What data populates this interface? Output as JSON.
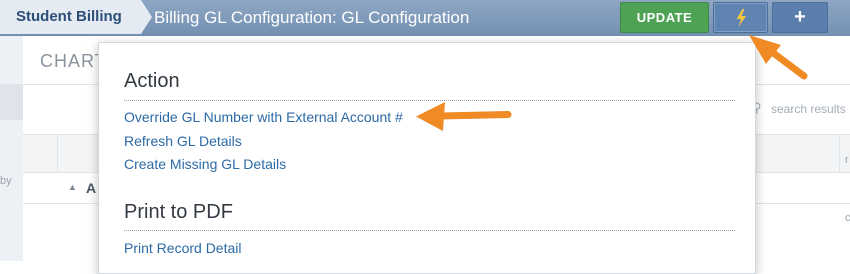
{
  "header": {
    "breadcrumb": "Student Billing",
    "title": "Billing GL Configuration: GL Configuration",
    "update_label": "UPDATE",
    "action_icon": "lightning-bolt-icon",
    "add_icon": "plus-icon",
    "add_glyph": "+"
  },
  "background": {
    "section_heading": "CHART",
    "column_label": "A",
    "side_text": "by",
    "search_placeholder": "search results"
  },
  "menu": {
    "sections": [
      {
        "title": "Action",
        "items": [
          "Override GL Number with External Account #",
          "Refresh GL Details",
          "Create Missing GL Details"
        ]
      },
      {
        "title": "Print to PDF",
        "items": [
          "Print Record Detail"
        ]
      }
    ]
  },
  "colors": {
    "header_bg": "#7f9aba",
    "update_green": "#4da353",
    "icon_button_blue": "#5a7fad",
    "bolt_yellow": "#f3c544",
    "link_blue": "#2c6aa6",
    "annotation_orange": "#f08a24"
  }
}
